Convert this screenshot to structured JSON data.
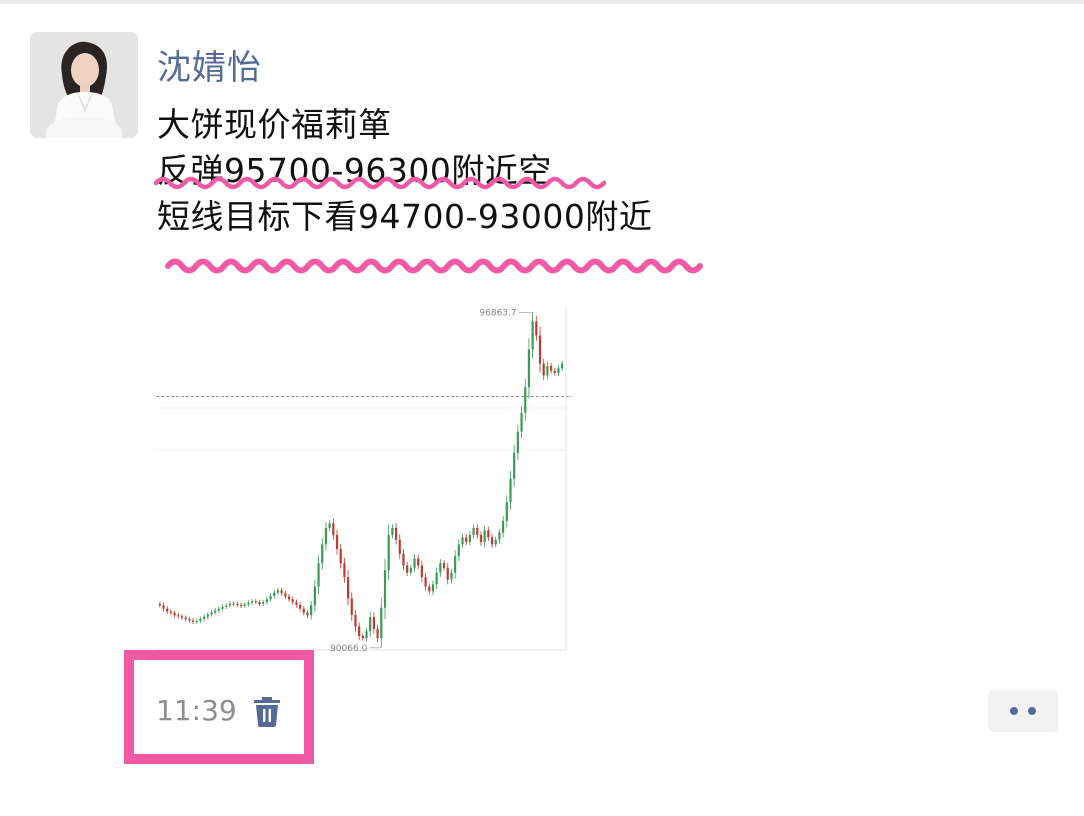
{
  "post": {
    "author": "沈婧怡",
    "lines": [
      "大饼现价福莉箪",
      "反弹95700-96300附近空",
      "短线目标下看94700-93000附近"
    ],
    "time": "11:39"
  },
  "icons": {
    "avatar": "profile-photo",
    "delete": "trash-icon",
    "more": "more-dots-icon"
  },
  "colors": {
    "name": "#566b94",
    "highlight": "#f05aa5",
    "up_candle": "#3a9a57",
    "down_candle": "#c0392b"
  },
  "chart_data": {
    "type": "candlestick",
    "title": "",
    "xlabel": "",
    "ylabel": "",
    "annotations": {
      "high": "96863.7",
      "low": "90066.0"
    },
    "ylim": [
      89900,
      97100
    ],
    "reference_level": 95300,
    "closes": [
      90850,
      90780,
      90720,
      90690,
      90640,
      90620,
      90590,
      90560,
      90530,
      90500,
      90520,
      90560,
      90610,
      90660,
      90700,
      90740,
      90780,
      90820,
      90850,
      90890,
      90880,
      90860,
      90840,
      90870,
      90910,
      90940,
      90920,
      90880,
      90920,
      90980,
      91050,
      91120,
      91170,
      91110,
      91040,
      90980,
      90920,
      90860,
      90780,
      90700,
      90640,
      90850,
      91250,
      91750,
      92150,
      92500,
      92600,
      92350,
      92050,
      91750,
      91450,
      91000,
      90650,
      90400,
      90200,
      90150,
      90300,
      90600,
      90350,
      90150,
      90800,
      91600,
      92350,
      92500,
      92250,
      91950,
      91700,
      91550,
      91650,
      91850,
      91700,
      91450,
      91250,
      91150,
      91300,
      91550,
      91750,
      91650,
      91400,
      91550,
      91900,
      92150,
      92300,
      92200,
      92350,
      92500,
      92350,
      92200,
      92450,
      92300,
      92150,
      92250,
      92400,
      92650,
      93050,
      93550,
      94100,
      94550,
      94950,
      95500,
      96300,
      96900,
      96600,
      96000,
      95750,
      95950,
      95850,
      95800,
      95900,
      96000
    ]
  }
}
